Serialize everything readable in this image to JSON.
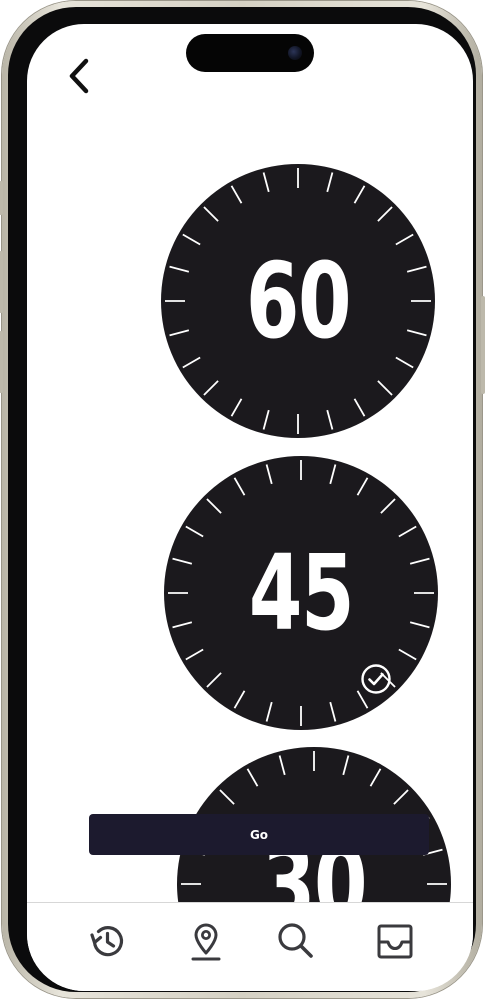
{
  "dials": [
    {
      "value": "60",
      "selected": false
    },
    {
      "value": "45",
      "selected": true
    },
    {
      "value": "30",
      "selected": false
    }
  ],
  "go_button": {
    "label": "Go"
  },
  "colors": {
    "dial_fill": "#1b191d",
    "tick": "#ffffff",
    "button_bg": "#1c1a2e",
    "icon": "#3a3a3e"
  },
  "icons": {
    "back": "chevron-left-icon",
    "selected": "check-circle-icon",
    "tabs": [
      "history-icon",
      "location-pin-icon",
      "search-icon",
      "inbox-icon"
    ]
  }
}
